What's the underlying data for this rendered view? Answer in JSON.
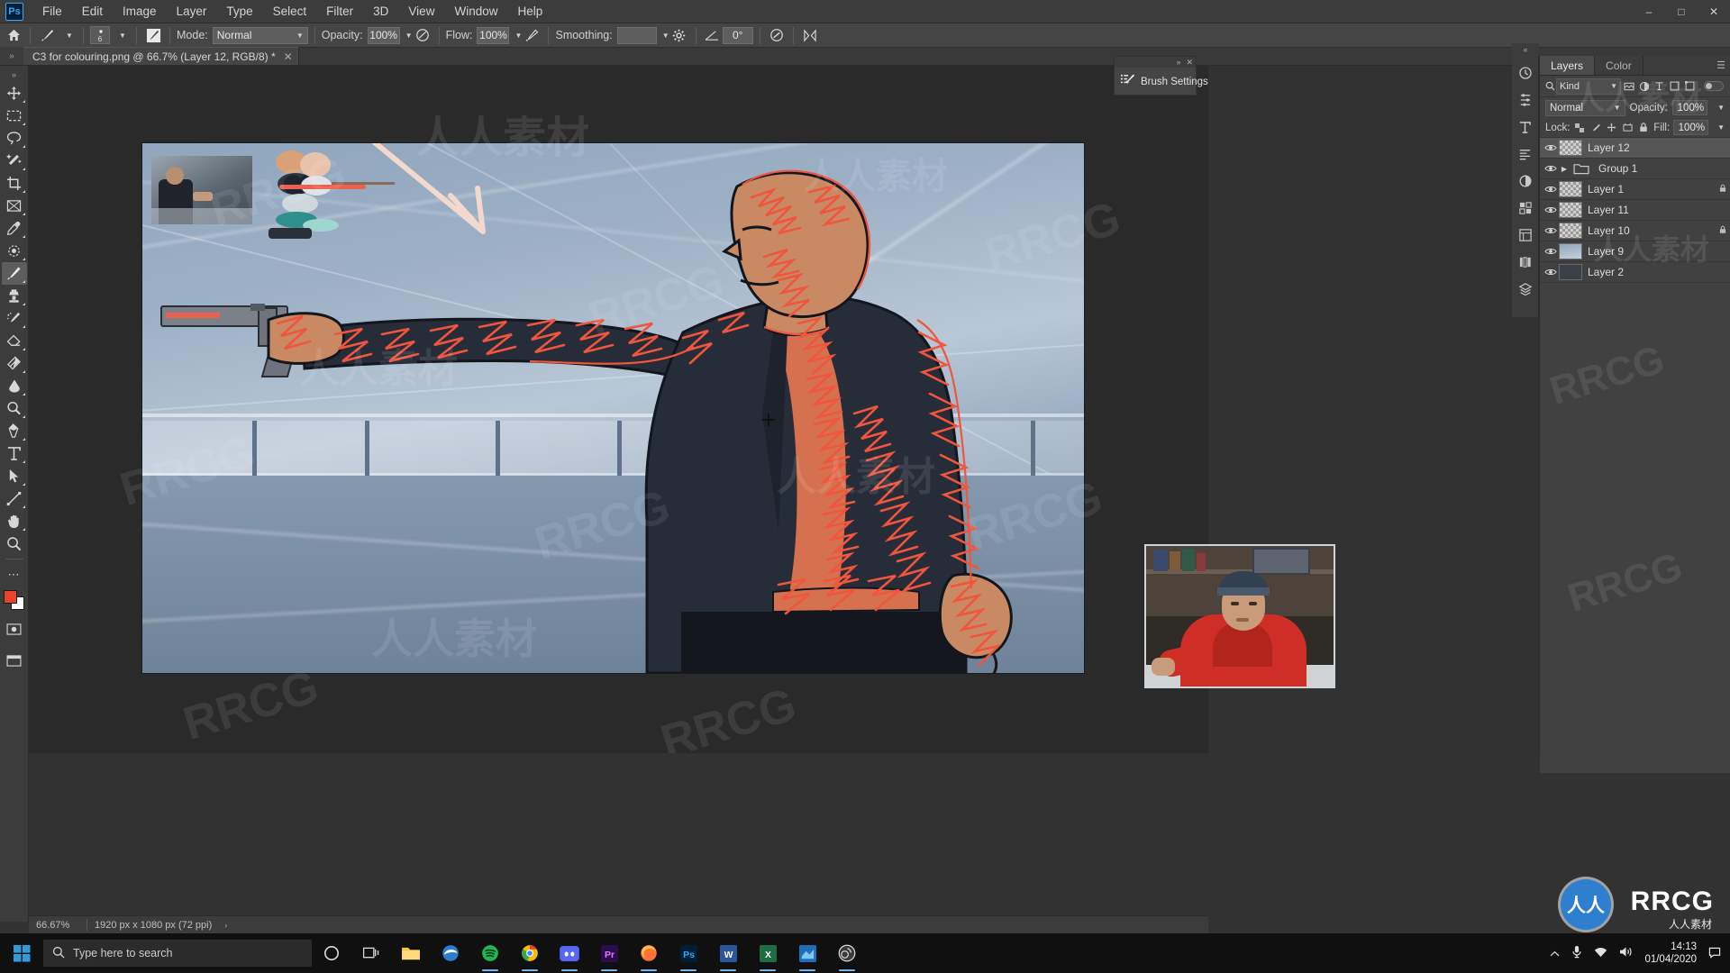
{
  "app": {
    "name": "Adobe Photoshop",
    "logo_text": "Ps"
  },
  "menu": {
    "items": [
      "File",
      "Edit",
      "Image",
      "Layer",
      "Type",
      "Select",
      "Filter",
      "3D",
      "View",
      "Window",
      "Help"
    ]
  },
  "window_controls": {
    "minimize": "–",
    "maximize": "□",
    "close": "✕"
  },
  "options_bar": {
    "home_icon": "home-icon",
    "brush_preset_icon": "brush-preset-icon",
    "brush_size_number": "6",
    "brush_panel_icon": "brush-panel-icon",
    "mode_label": "Mode:",
    "mode_value": "Normal",
    "opacity_label": "Opacity:",
    "opacity_value": "100%",
    "pressure_opacity_icon": "pressure-opacity-icon",
    "flow_label": "Flow:",
    "flow_value": "100%",
    "airbrush_icon": "airbrush-icon",
    "smoothing_label": "Smoothing:",
    "smoothing_value": "",
    "smoothing_options_icon": "gear-icon",
    "angle_label": "0°",
    "angle_icon": "angle-icon",
    "pressure_size_icon": "pressure-size-icon",
    "symmetry_icon": "symmetry-icon"
  },
  "tab_bar": {
    "arrows": "»",
    "document_title": "C3 for colouring.png @ 66.7% (Layer 12, RGB/8) *",
    "close": "✕"
  },
  "toolbar": {
    "tools": [
      {
        "name": "move-tool",
        "label": "Move Tool",
        "active": false
      },
      {
        "name": "rectangular-marquee-tool",
        "label": "Rectangular Marquee Tool",
        "active": false
      },
      {
        "name": "lasso-tool",
        "label": "Lasso Tool",
        "active": false
      },
      {
        "name": "magic-wand-tool",
        "label": "Object Selection Tool",
        "active": false
      },
      {
        "name": "crop-tool",
        "label": "Crop Tool",
        "active": false
      },
      {
        "name": "frame-tool",
        "label": "Frame Tool",
        "active": false
      },
      {
        "name": "eyedropper-tool",
        "label": "Eyedropper Tool",
        "active": false
      },
      {
        "name": "spot-healing-brush-tool",
        "label": "Spot Healing Brush Tool",
        "active": false
      },
      {
        "name": "brush-tool",
        "label": "Brush Tool",
        "active": true
      },
      {
        "name": "clone-stamp-tool",
        "label": "Clone Stamp Tool",
        "active": false
      },
      {
        "name": "history-brush-tool",
        "label": "History Brush Tool",
        "active": false
      },
      {
        "name": "eraser-tool",
        "label": "Eraser Tool",
        "active": false
      },
      {
        "name": "gradient-tool",
        "label": "Gradient Tool",
        "active": false
      },
      {
        "name": "blur-tool",
        "label": "Blur Tool",
        "active": false
      },
      {
        "name": "dodge-tool",
        "label": "Dodge Tool",
        "active": false
      },
      {
        "name": "pen-tool",
        "label": "Pen Tool",
        "active": false
      },
      {
        "name": "type-tool",
        "label": "Horizontal Type Tool",
        "active": false
      },
      {
        "name": "path-selection-tool",
        "label": "Path Selection Tool",
        "active": false
      },
      {
        "name": "line-tool",
        "label": "Line Tool",
        "active": false
      },
      {
        "name": "hand-tool",
        "label": "Hand Tool",
        "active": false
      },
      {
        "name": "zoom-tool",
        "label": "Zoom Tool",
        "active": false
      },
      {
        "name": "more-tools",
        "label": "Edit Toolbar",
        "active": false
      }
    ],
    "foreground_color": "#e8442c",
    "background_color": "#ffffff",
    "quick_mask_icon": "quick-mask-icon",
    "screen_mode_icon": "screen-mode-icon"
  },
  "brush_settings_flyout": {
    "label": "Brush Settings",
    "icon": "brush-settings-icon",
    "collapse": "»",
    "close": "✕"
  },
  "dock_icons": [
    {
      "name": "history-panel-icon"
    },
    {
      "name": "adjustments-panel-icon"
    },
    {
      "name": "character-panel-icon"
    },
    {
      "name": "paragraph-panel-icon"
    },
    {
      "name": "color-panel-icon"
    },
    {
      "name": "swatches-panel-icon"
    },
    {
      "name": "properties-panel-icon"
    },
    {
      "name": "libraries-panel-icon"
    },
    {
      "name": "layers-panel-icon"
    }
  ],
  "dock_collapse": "«",
  "layers_panel": {
    "tabs": [
      {
        "label": "Layers",
        "active": true
      },
      {
        "label": "Color",
        "active": false
      }
    ],
    "filter": {
      "search_icon": "search-icon",
      "kind_label": "Kind",
      "icons": [
        "pixel-filter-icon",
        "adjustment-filter-icon",
        "type-filter-icon",
        "shape-filter-icon",
        "smart-object-filter-icon"
      ],
      "toggle": "filter-toggle"
    },
    "blend_mode": "Normal",
    "opacity_label": "Opacity:",
    "opacity_value": "100%",
    "lock_label": "Lock:",
    "lock_icons": [
      "lock-transparent-pixels",
      "lock-image-pixels",
      "lock-position",
      "lock-artboard-nesting",
      "lock-all"
    ],
    "fill_label": "Fill:",
    "fill_value": "100%",
    "layers": [
      {
        "name": "Layer 12",
        "visible": true,
        "selected": true,
        "locked": false,
        "thumb": "checker",
        "group": false
      },
      {
        "name": "Group 1",
        "visible": true,
        "selected": false,
        "locked": false,
        "thumb": "folder",
        "group": true
      },
      {
        "name": "Layer 1",
        "visible": true,
        "selected": false,
        "locked": true,
        "thumb": "checker",
        "group": false
      },
      {
        "name": "Layer 11",
        "visible": true,
        "selected": false,
        "locked": false,
        "thumb": "checker",
        "group": false
      },
      {
        "name": "Layer 10",
        "visible": true,
        "selected": false,
        "locked": true,
        "thumb": "checker",
        "group": false
      },
      {
        "name": "Layer 9",
        "visible": true,
        "selected": false,
        "locked": false,
        "thumb": "sky",
        "group": false
      },
      {
        "name": "Layer 2",
        "visible": true,
        "selected": false,
        "locked": false,
        "thumb": "dark",
        "group": false
      }
    ]
  },
  "status_bar": {
    "zoom": "66.67%",
    "dimensions": "1920 px x 1080 px (72 ppi)",
    "arrow": "›"
  },
  "taskbar": {
    "start_icon": "windows-start-icon",
    "search_icon": "search-icon",
    "search_placeholder": "Type here to search",
    "cortana_icon": "cortana-icon",
    "task_view_icon": "task-view-icon",
    "apps": [
      {
        "name": "file-explorer-icon",
        "running": false
      },
      {
        "name": "microsoft-edge-icon",
        "running": false
      },
      {
        "name": "spotify-icon",
        "running": true
      },
      {
        "name": "google-chrome-icon",
        "running": true
      },
      {
        "name": "discord-icon",
        "running": true
      },
      {
        "name": "premiere-pro-icon",
        "running": true
      },
      {
        "name": "firefox-icon",
        "running": true
      },
      {
        "name": "photoshop-icon",
        "running": true
      },
      {
        "name": "word-icon",
        "running": true
      },
      {
        "name": "excel-icon",
        "running": true
      },
      {
        "name": "powerpoint-icon",
        "running": true
      },
      {
        "name": "obs-icon",
        "running": true
      }
    ],
    "tray": {
      "show_hidden_icon": "chevron-up-icon",
      "microphone_icon": "microphone-icon",
      "network_icon": "network-icon",
      "volume_icon": "volume-icon",
      "time": "14:13",
      "date": "01/04/2020",
      "notification_icon": "notification-icon"
    }
  },
  "watermarks": {
    "latin": "RRCG",
    "chinese": "人人素材",
    "badge_text": "人人",
    "logo_text": "RRCG",
    "logo_sub": "人人素材"
  }
}
